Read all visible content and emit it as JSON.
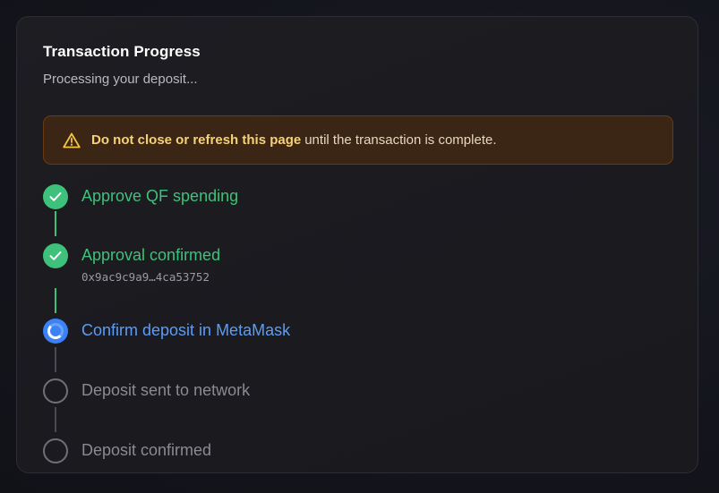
{
  "card": {
    "title": "Transaction Progress",
    "subtitle": "Processing your deposit..."
  },
  "warning": {
    "icon": "warning-triangle-icon",
    "strong_text": "Do not close or refresh this page",
    "rest_text": "until the transaction is complete.",
    "colors": {
      "background": "#3b2514",
      "border": "#6b3a14",
      "strong": "#f5d27a"
    }
  },
  "steps": [
    {
      "label": "Approve QF spending",
      "status": "completed"
    },
    {
      "label": "Approval confirmed",
      "status": "completed",
      "tx_hash": "0x9ac9c9a9…4ca53752"
    },
    {
      "label": "Confirm deposit in MetaMask",
      "status": "in-progress"
    },
    {
      "label": "Deposit sent to network",
      "status": "pending"
    },
    {
      "label": "Deposit confirmed",
      "status": "pending"
    }
  ],
  "colors": {
    "completed": "#3ec17b",
    "in_progress": "#3b82f6",
    "pending": "#6f6f78"
  }
}
